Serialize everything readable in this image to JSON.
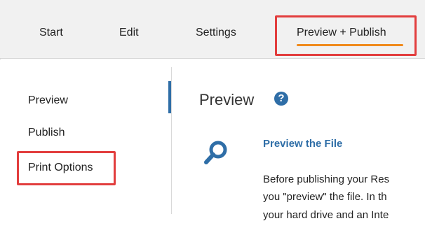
{
  "tabs": {
    "start": "Start",
    "edit": "Edit",
    "settings": "Settings",
    "preview_publish": "Preview + Publish"
  },
  "sidebar": {
    "items": [
      "Preview",
      "Publish",
      "Print Options"
    ]
  },
  "main": {
    "title": "Preview",
    "section_title": "Preview the File",
    "body_lines": [
      "Before publishing your Res",
      "you \"preview\" the file.  In th",
      "your hard drive and an Inte"
    ]
  },
  "colors": {
    "accent": "#2f6ea7",
    "tab_underline": "#f08a1c",
    "highlight": "#e23d3d"
  },
  "icons": {
    "help": "help-icon",
    "search": "search-icon"
  }
}
